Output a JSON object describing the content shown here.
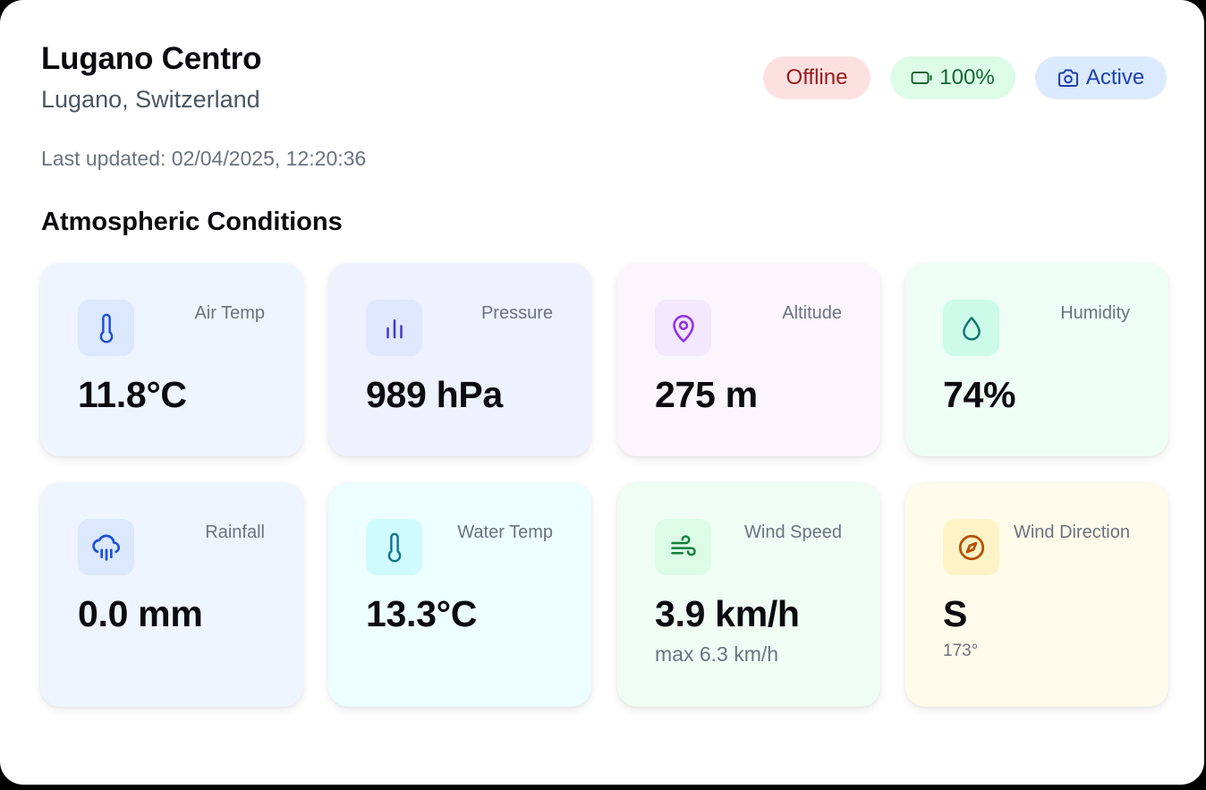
{
  "station": {
    "name": "Lugano Centro",
    "location": "Lugano, Switzerland",
    "last_updated": "Last updated: 02/04/2025, 12:20:36"
  },
  "badges": {
    "status": "Offline",
    "battery": "100%",
    "camera": "Active"
  },
  "section_title": "Atmospheric Conditions",
  "tiles": {
    "air_temp": {
      "label": "Air Temp",
      "value": "11.8°C",
      "icon": "thermometer-icon",
      "bg": "#eff5ff",
      "icon_bg": "#dbe8fd",
      "icon_color": "#1d4ed8"
    },
    "pressure": {
      "label": "Pressure",
      "value": "989 hPa",
      "icon": "bar-chart-icon",
      "bg": "#eef2fe",
      "icon_bg": "#e0e7ff",
      "icon_color": "#4338ca"
    },
    "altitude": {
      "label": "Altitude",
      "value": "275 m",
      "icon": "map-pin-icon",
      "bg": "#fbf5fe",
      "icon_bg": "#f3e8ff",
      "icon_color": "#9333ea"
    },
    "humidity": {
      "label": "Humidity",
      "value": "74%",
      "icon": "droplet-icon",
      "bg": "#effdf7",
      "icon_bg": "#ccfbea",
      "icon_color": "#0f766e"
    },
    "rainfall": {
      "label": "Rainfall",
      "value": "0.0 mm",
      "icon": "cloud-rain-icon",
      "bg": "#eff5ff",
      "icon_bg": "#dbe8fd",
      "icon_color": "#1d4ed8"
    },
    "water_temp": {
      "label": "Water Temp",
      "value": "13.3°C",
      "icon": "thermometer-icon",
      "bg": "#ecfeff",
      "icon_bg": "#cffafe",
      "icon_color": "#0e7490"
    },
    "wind_speed": {
      "label": "Wind Speed",
      "value": "3.9 km/h",
      "sub": "max 6.3 km/h",
      "icon": "wind-icon",
      "bg": "#f0fdf4",
      "icon_bg": "#dcfce7",
      "icon_color": "#15803d"
    },
    "wind_direction": {
      "label": "Wind Direction",
      "value": "S",
      "sub": "173°",
      "icon": "compass-icon",
      "bg": "#fffbea",
      "icon_bg": "#fef3c7",
      "icon_color": "#b45309"
    }
  }
}
